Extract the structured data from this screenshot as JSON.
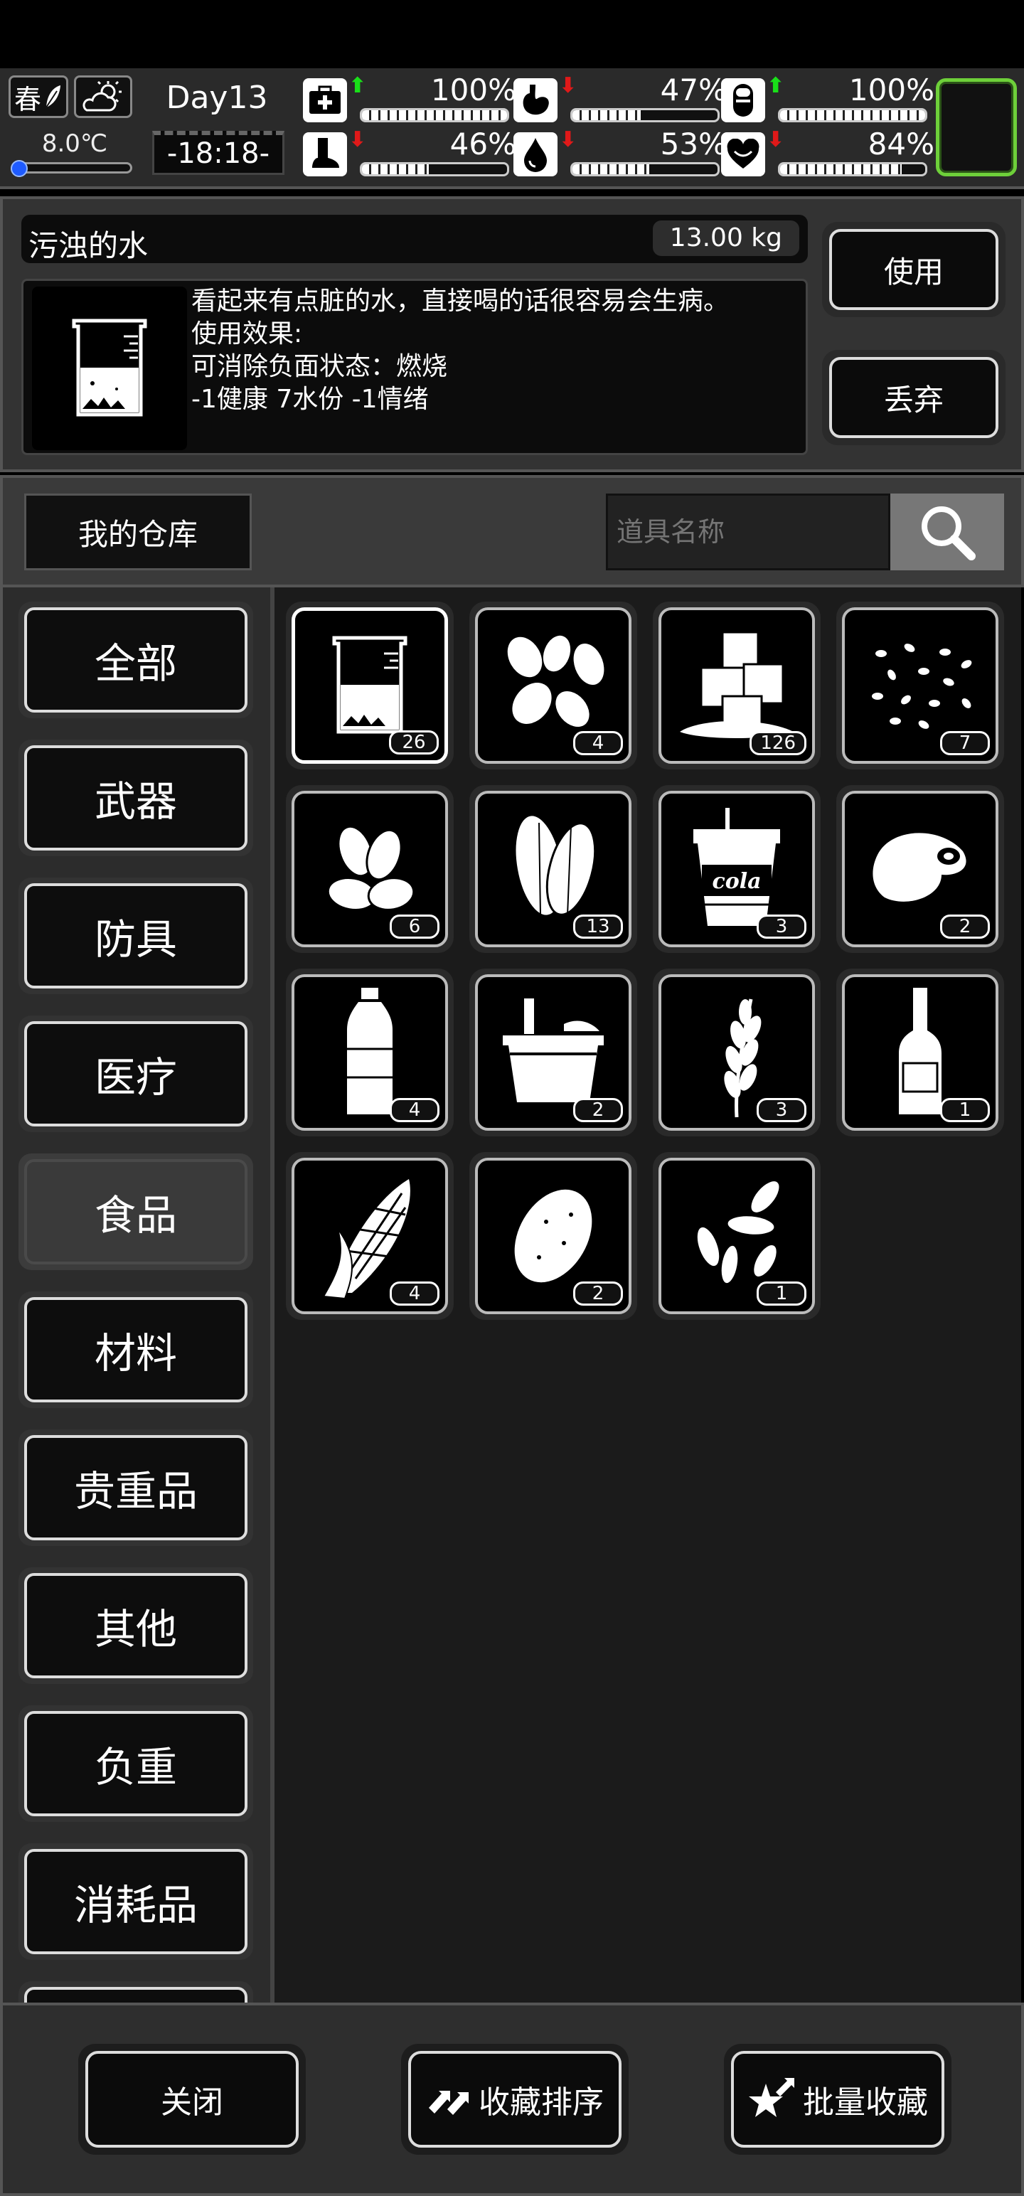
{
  "status": {
    "season": "春",
    "temperature": "8.0℃",
    "day": "Day13",
    "time": "-18:18-",
    "stats": [
      {
        "id": "health",
        "icon": "medkit-icon",
        "trend": "up",
        "percent": "100%",
        "level": 1.0
      },
      {
        "id": "hunger",
        "icon": "stomach-icon",
        "trend": "down",
        "percent": "47%",
        "level": 0.47
      },
      {
        "id": "energy",
        "icon": "pill-icon",
        "trend": "up",
        "percent": "100%",
        "level": 1.0
      },
      {
        "id": "stamina",
        "icon": "foot-icon",
        "trend": "down",
        "percent": "46%",
        "level": 0.46
      },
      {
        "id": "thirst",
        "icon": "water-drop-icon",
        "trend": "down",
        "percent": "53%",
        "level": 0.53
      },
      {
        "id": "mood",
        "icon": "heart-icon",
        "trend": "down",
        "percent": "84%",
        "level": 0.84
      }
    ],
    "arrows": {
      "up": "⬆",
      "down": "⬇"
    }
  },
  "item": {
    "name": "污浊的水",
    "weight": "13.00 kg",
    "desc_lines": [
      "看起来有点脏的水，直接喝的话很容易会生病。",
      "使用效果:",
      "可消除负面状态：燃烧",
      "-1健康 7水份 -1情绪"
    ],
    "use_label": "使用",
    "discard_label": "丢弃"
  },
  "warehouse": {
    "title": "我的仓库",
    "search_placeholder": "道具名称"
  },
  "categories": [
    "全部",
    "武器",
    "防具",
    "医疗",
    "食品",
    "材料",
    "贵重品",
    "其他",
    "负重",
    "消耗品"
  ],
  "active_category": "食品",
  "items": [
    {
      "name": "dirty-water",
      "count": "26",
      "selected": true
    },
    {
      "name": "peanuts",
      "count": "4"
    },
    {
      "name": "ice",
      "count": "126"
    },
    {
      "name": "seeds",
      "count": "7"
    },
    {
      "name": "almonds",
      "count": "6"
    },
    {
      "name": "pumpkin-seeds",
      "count": "13"
    },
    {
      "name": "cola",
      "count": "3",
      "label": "cola"
    },
    {
      "name": "meat",
      "count": "2"
    },
    {
      "name": "water-bottle",
      "count": "4"
    },
    {
      "name": "bucket",
      "count": "2"
    },
    {
      "name": "wheat",
      "count": "3"
    },
    {
      "name": "liquor-bottle",
      "count": "1"
    },
    {
      "name": "corn",
      "count": "4"
    },
    {
      "name": "potato",
      "count": "2"
    },
    {
      "name": "sunflower-seeds",
      "count": "1"
    }
  ],
  "bottom": {
    "close_label": "关闭",
    "sort_label": "收藏排序",
    "batch_label": "批量收藏"
  }
}
